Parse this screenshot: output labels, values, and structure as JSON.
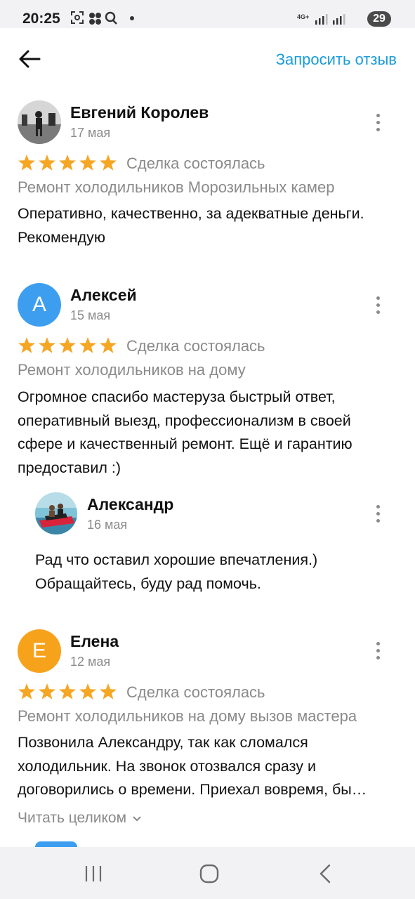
{
  "status_bar": {
    "time": "20:25",
    "battery": "29",
    "network": "4G+",
    "icons": [
      "screenshot-icon",
      "apps-icon",
      "search-icon",
      "dot-icon",
      "signal-icon",
      "battery-icon"
    ]
  },
  "header": {
    "back_icon": "arrow-left-icon",
    "request_review": "Запросить отзыв"
  },
  "colors": {
    "accent": "#1a9bdb",
    "star": "#f5a623",
    "muted": "#8a8a8a",
    "avatar_blue": "#3d9ef0",
    "avatar_orange": "#f7a21b"
  },
  "reviews": [
    {
      "author": "Евгений Королев",
      "date": "17 мая",
      "rating": 5,
      "deal": "Сделка состоялась",
      "service": "Ремонт холодильников Морозильных камер",
      "text": "Оперативно, качественно, за адекватные деньги. Рекомендую"
    },
    {
      "author": "Алексей",
      "avatar_letter": "А",
      "date": "15 мая",
      "rating": 5,
      "deal": "Сделка состоялась",
      "service": "Ремонт холодильников на дому",
      "text": "Огромное спасибо мастеруза быстрый ответ, оперативный выезд, профессионализм в своей сфере и качественный ремонт. Ещё и гарантию предоставил :)",
      "reply": {
        "author": "Александр",
        "date": "16 мая",
        "text": "Рад что оставил хорошие впечатления.) Обращайтесь, буду рад помочь."
      }
    },
    {
      "author": "Елена",
      "avatar_letter": "Е",
      "date": "12 мая",
      "rating": 5,
      "deal": "Сделка состоялась",
      "service": "Ремонт холодильников на дому вызов мастера",
      "text": "Позвонила Александру, так как сломался холодильник. На звонок отозвался сразу и договорились о времени. Приехал вовремя, бы…",
      "read_more": "Читать целиком"
    }
  ],
  "nav_bar": {
    "items": [
      "recents-icon",
      "home-icon",
      "back-icon"
    ]
  }
}
